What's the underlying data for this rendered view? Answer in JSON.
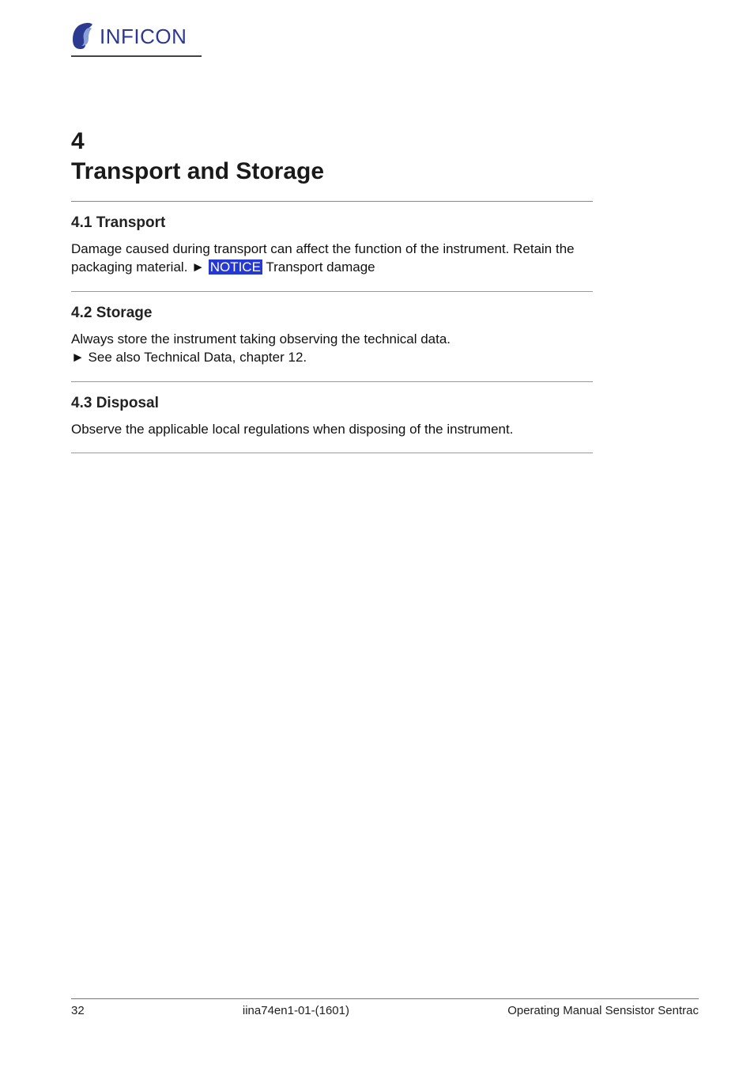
{
  "logo": {
    "text": "INFICON"
  },
  "section": {
    "number": "4",
    "title": "Transport and Storage"
  },
  "sub1": {
    "heading": "4.1 Transport",
    "body_prefix": "Damage caused during transport can affect the function of the instrument. Retain the packaging material. ► ",
    "body_link_text": "NOTICE",
    "body_suffix": " Transport damage"
  },
  "sub2": {
    "heading": "4.2 Storage",
    "body": "Always store the instrument taking observing the technical data.\n► See also Technical Data, chapter 12."
  },
  "sub3": {
    "heading": "4.3 Disposal",
    "body": "Observe the applicable local regulations when disposing of the instrument."
  },
  "footer": {
    "left": "32",
    "center": "iina74en1-01-(1601)",
    "right": "Operating Manual Sensistor Sentrac"
  }
}
